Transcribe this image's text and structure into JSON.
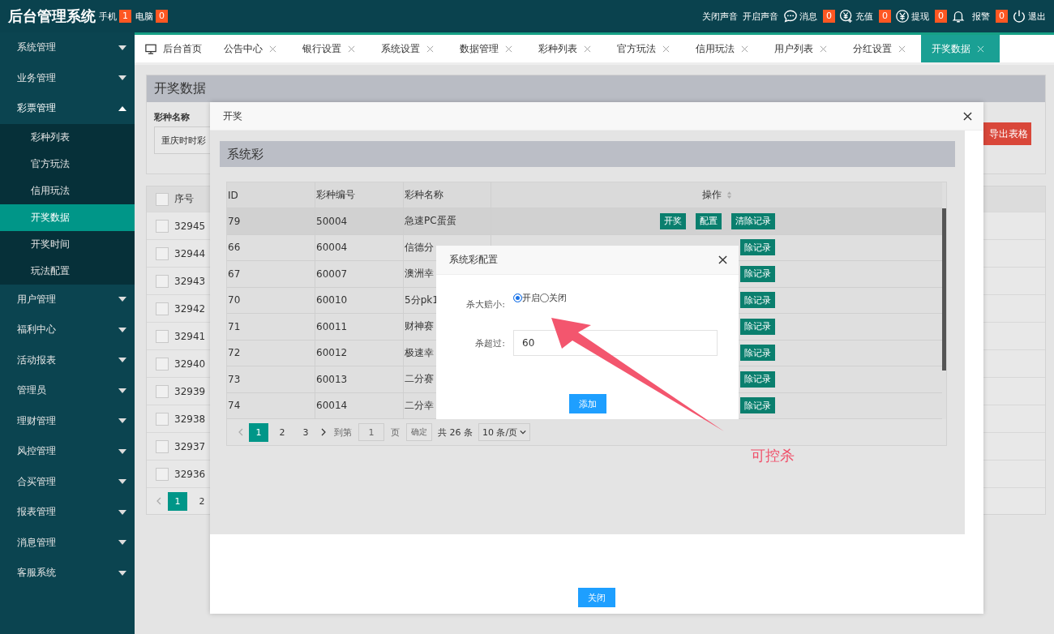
{
  "header": {
    "title": "后台管理系统",
    "badges": [
      {
        "label": "手机",
        "count": "1"
      },
      {
        "label": "电脑",
        "count": "0"
      }
    ],
    "actions": [
      {
        "kind": "text",
        "label": "关闭声音"
      },
      {
        "kind": "text",
        "label": "开启声音"
      },
      {
        "kind": "chat",
        "label": "消息",
        "count": "0"
      },
      {
        "kind": "recharge",
        "label": "充值",
        "count": "0"
      },
      {
        "kind": "withdraw",
        "label": "提现",
        "count": "0"
      },
      {
        "kind": "bell",
        "label": "报警",
        "count": "0"
      },
      {
        "kind": "power",
        "label": "退出"
      }
    ]
  },
  "sidebar": {
    "items": [
      {
        "label": "系统管理",
        "expanded": false
      },
      {
        "label": "业务管理",
        "expanded": false
      },
      {
        "label": "彩票管理",
        "expanded": true,
        "children": [
          {
            "label": "彩种列表",
            "selected": false
          },
          {
            "label": "官方玩法",
            "selected": false
          },
          {
            "label": "信用玩法",
            "selected": false
          },
          {
            "label": "开奖数据",
            "selected": true
          },
          {
            "label": "开奖时间",
            "selected": false
          },
          {
            "label": "玩法配置",
            "selected": false
          }
        ]
      },
      {
        "label": "用户管理",
        "expanded": false
      },
      {
        "label": "福利中心",
        "expanded": false
      },
      {
        "label": "活动报表",
        "expanded": false
      },
      {
        "label": "管理员",
        "expanded": false
      },
      {
        "label": "理财管理",
        "expanded": false
      },
      {
        "label": "风控管理",
        "expanded": false
      },
      {
        "label": "合买管理",
        "expanded": false
      },
      {
        "label": "报表管理",
        "expanded": false
      },
      {
        "label": "消息管理",
        "expanded": false
      },
      {
        "label": "客服系统",
        "expanded": false
      }
    ]
  },
  "tabs": [
    {
      "kind": "home",
      "label": "后台首页",
      "selected": false
    },
    {
      "kind": "page",
      "label": "公告中心",
      "selected": false
    },
    {
      "kind": "page",
      "label": "银行设置",
      "selected": false
    },
    {
      "kind": "page",
      "label": "系统设置",
      "selected": false
    },
    {
      "kind": "page",
      "label": "数据管理",
      "selected": false
    },
    {
      "kind": "page",
      "label": "彩种列表",
      "selected": false
    },
    {
      "kind": "page",
      "label": "官方玩法",
      "selected": false
    },
    {
      "kind": "page",
      "label": "信用玩法",
      "selected": false
    },
    {
      "kind": "page",
      "label": "用户列表",
      "selected": false
    },
    {
      "kind": "page",
      "label": "分红设置",
      "selected": false
    },
    {
      "kind": "page",
      "label": "开奖数据",
      "selected": true
    }
  ],
  "page": {
    "title": "开奖数据",
    "filter": {
      "label": "彩种名称",
      "value": "重庆时时彩"
    },
    "export_button": "导出表格",
    "table": {
      "columns": [
        "序号"
      ],
      "all_checked": false,
      "rows": [
        {
          "id": "32945",
          "checked": false
        },
        {
          "id": "32944",
          "checked": false
        },
        {
          "id": "32943",
          "checked": false
        },
        {
          "id": "32942",
          "checked": false
        },
        {
          "id": "32941",
          "checked": false
        },
        {
          "id": "32940",
          "checked": false
        },
        {
          "id": "32939",
          "checked": false
        },
        {
          "id": "32938",
          "checked": false
        },
        {
          "id": "32937",
          "checked": false
        },
        {
          "id": "32936",
          "checked": false
        }
      ]
    },
    "pagination": {
      "pages": [
        {
          "label": "1",
          "selected": true
        },
        {
          "label": "2",
          "selected": false
        }
      ]
    }
  },
  "draw_dialog": {
    "title": "开奖",
    "section_title": "系统彩",
    "table": {
      "columns": [
        "ID",
        "彩种编号",
        "彩种名称",
        "操作"
      ],
      "rows": [
        {
          "cells": [
            "79",
            "50004",
            "急速PC蛋蛋"
          ],
          "actions": [
            "开奖",
            "配置",
            "清除记录"
          ],
          "selected": true
        },
        {
          "cells": [
            "66",
            "60004",
            "信德分"
          ],
          "actions": [
            "除记录"
          ],
          "selected": false
        },
        {
          "cells": [
            "67",
            "60007",
            "澳洲幸"
          ],
          "actions": [
            "除记录"
          ],
          "selected": false
        },
        {
          "cells": [
            "70",
            "60010",
            "5分pk1"
          ],
          "actions": [
            "除记录"
          ],
          "selected": false
        },
        {
          "cells": [
            "71",
            "60011",
            "财神赛"
          ],
          "actions": [
            "除记录"
          ],
          "selected": false
        },
        {
          "cells": [
            "72",
            "60012",
            "极速幸"
          ],
          "actions": [
            "除记录"
          ],
          "selected": false
        },
        {
          "cells": [
            "73",
            "60013",
            "二分赛"
          ],
          "actions": [
            "除记录"
          ],
          "selected": false
        },
        {
          "cells": [
            "74",
            "60014",
            "二分幸"
          ],
          "actions": [
            "除记录"
          ],
          "selected": false
        }
      ]
    },
    "pagination": {
      "pages": [
        {
          "label": "1",
          "selected": true
        },
        {
          "label": "2",
          "selected": false
        },
        {
          "label": "3",
          "selected": false
        }
      ],
      "goto_label": "到第",
      "goto_value": "1",
      "page_unit": "页",
      "confirm": "确定",
      "total": "共 26 条",
      "page_size": "10 条/页"
    },
    "close_button": "关闭"
  },
  "config_dialog": {
    "title": "系统彩配置",
    "fields": [
      {
        "kind": "radio",
        "label": "杀大赔小:",
        "options": [
          {
            "label": "开启",
            "selected": true
          },
          {
            "label": "关闭",
            "selected": false
          }
        ]
      },
      {
        "kind": "input",
        "label": "杀超过:",
        "value": "60"
      }
    ],
    "submit": "添加"
  },
  "annotation": {
    "text": "可控杀"
  }
}
